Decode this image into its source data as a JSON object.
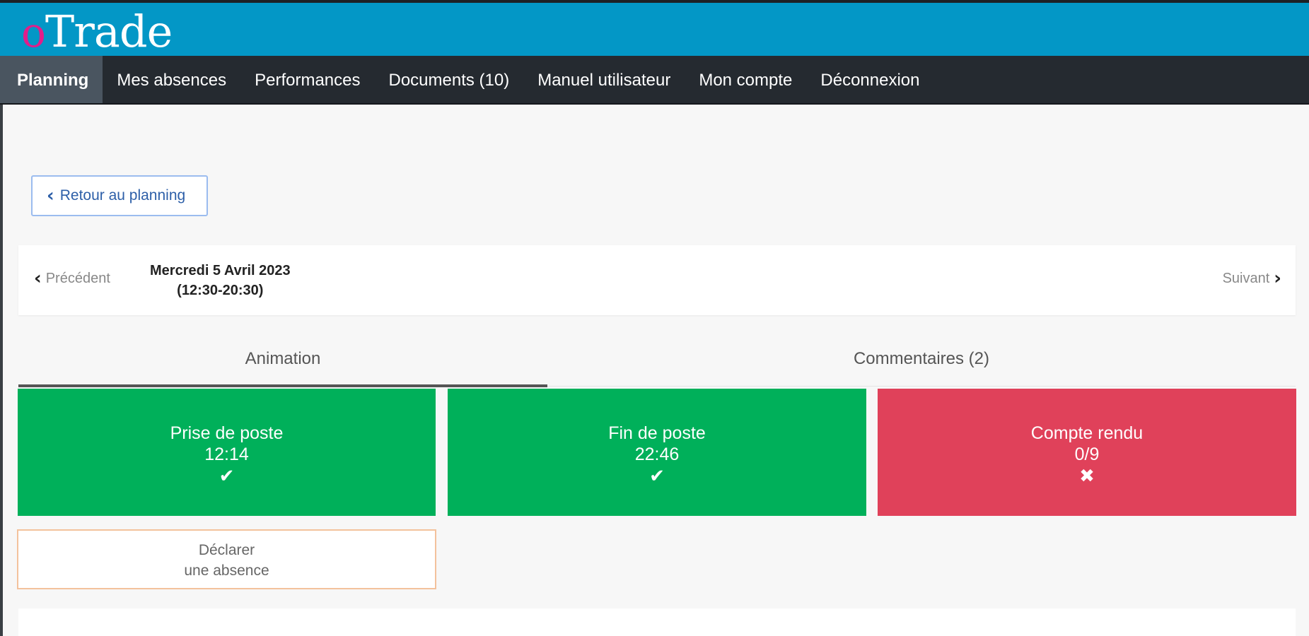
{
  "app": {
    "logo_prefix": "o",
    "logo_rest": "Trade"
  },
  "nav": {
    "items": [
      {
        "label": "Planning",
        "active": true
      },
      {
        "label": "Mes absences"
      },
      {
        "label": "Performances"
      },
      {
        "label": "Documents (10)"
      },
      {
        "label": "Manuel utilisateur"
      },
      {
        "label": "Mon compte"
      },
      {
        "label": "Déconnexion"
      }
    ]
  },
  "back_button": {
    "label": "Retour au planning",
    "icon": "chevron-left-icon"
  },
  "day": {
    "prev_label": "Précédent",
    "next_label": "Suivant",
    "date": "Mercredi 5 Avril 2023",
    "hours": "(12:30-20:30)"
  },
  "tabs": [
    {
      "label": "Animation",
      "active": true
    },
    {
      "label": "Commentaires (2)"
    }
  ],
  "tiles": [
    {
      "title": "Prise de poste",
      "value": "12:14",
      "status": "done",
      "icon": "check-icon",
      "color": "#00b05a"
    },
    {
      "title": "Fin de poste",
      "value": "22:46",
      "status": "done",
      "icon": "check-icon",
      "color": "#00b05a"
    },
    {
      "title": "Compte rendu",
      "value": "0/9",
      "status": "missing",
      "icon": "x-icon",
      "color": "#e0415a"
    }
  ],
  "absence_button": {
    "line1": "Déclarer",
    "line2": "une absence"
  }
}
